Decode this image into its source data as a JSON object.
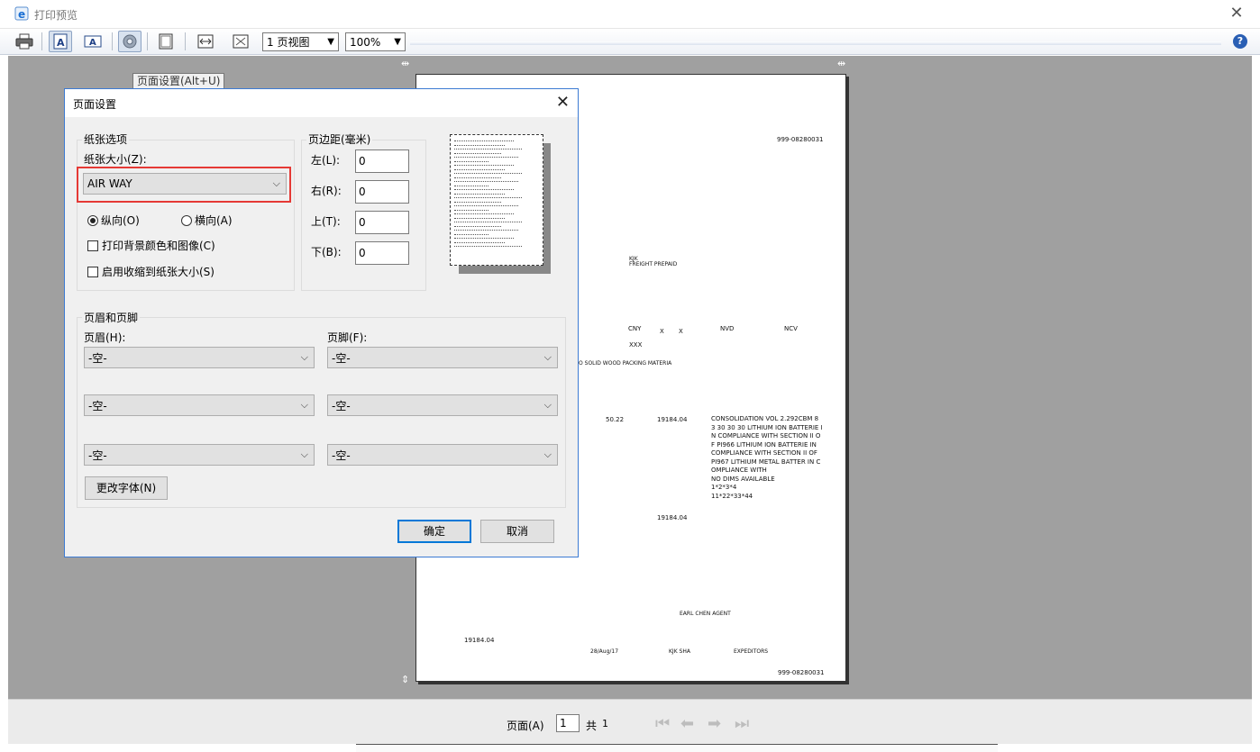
{
  "window": {
    "title": "打印预览"
  },
  "toolbar": {
    "view_mode": "1 页视图",
    "zoom": "100%",
    "tooltip": "页面设置(Alt+U)"
  },
  "page_preview": {
    "awb_top": "999-08280031",
    "kjk": "KJK",
    "freight": "FREIGHT PREPAID",
    "cny": "CNY",
    "x1": "X",
    "x2": "X",
    "nvd": "NVD",
    "ncv": "NCV",
    "xxx": "XXX",
    "packing": "O SOLID WOOD PACKING MATERIA",
    "weight": "50.22",
    "amount1": "19184.04",
    "desc": [
      "CONSOLIDATION VOL 2.292CBM 8",
      "3 30 30 30 LITHIUM ION BATTERIE I",
      "N COMPLIANCE WITH SECTION II O",
      "F PI966 LITHIUM ION BATTERIE IN",
      "COMPLIANCE WITH SECTION II OF",
      "PI967 LITHIUM METAL BATTER IN C",
      "OMPLIANCE WITH",
      "NO DIMS AVAILABLE",
      "1*2*3*4",
      "11*22*33*44"
    ],
    "amount2": "19184.04",
    "agent": "EARL CHEN AGENT",
    "amount3": "19184.04",
    "date": "28/Aug/17",
    "place": "KJK SHA",
    "expeditors": "EXPEDITORS",
    "awb_bottom": "999-08280031"
  },
  "status": {
    "page_label": "页面(A)",
    "page_value": "1",
    "total_label": "共",
    "total_value": "1"
  },
  "dialog": {
    "title": "页面设置",
    "paper_group": "纸张选项",
    "paper_size_label": "纸张大小(Z):",
    "paper_size_value": "AIR WAY",
    "portrait": "纵向(O)",
    "landscape": "横向(A)",
    "print_bg": "打印背景颜色和图像(C)",
    "shrink": "启用收缩到纸张大小(S)",
    "margins_group": "页边距(毫米)",
    "left_label": "左(L):",
    "left_value": "0",
    "right_label": "右(R):",
    "right_value": "0",
    "top_label": "上(T):",
    "top_value": "0",
    "bottom_label": "下(B):",
    "bottom_value": "0",
    "hf_group": "页眉和页脚",
    "header_label": "页眉(H):",
    "footer_label": "页脚(F):",
    "header_values": [
      "-空-",
      "-空-",
      "-空-"
    ],
    "footer_values": [
      "-空-",
      "-空-",
      "-空-"
    ],
    "change_font": "更改字体(N)",
    "ok": "确定",
    "cancel": "取消"
  }
}
